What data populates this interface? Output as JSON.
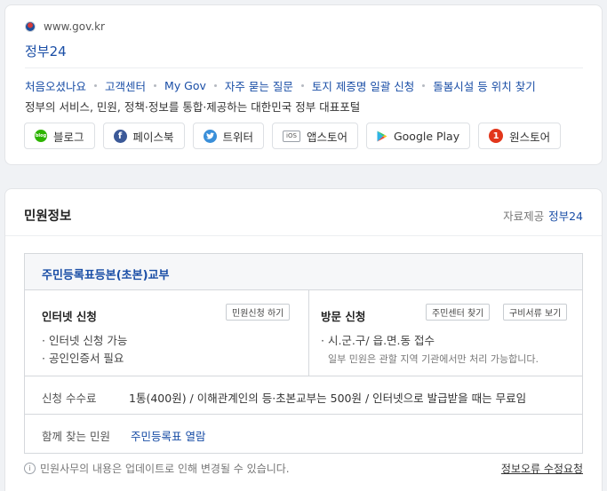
{
  "site": {
    "url": "www.gov.kr",
    "title": "정부24",
    "links": [
      "처음오셨나요",
      "고객센터",
      "My Gov",
      "자주 묻는 질문",
      "토지 제증명 일괄 신청",
      "돌봄시설 등 위치 찾기"
    ],
    "description": "정부의 서비스, 민원, 정책·정보를 통합·제공하는 대한민국 정부 대표포털",
    "apps": [
      {
        "icon": "blog-icon",
        "label": "블로그"
      },
      {
        "icon": "facebook-icon",
        "label": "페이스북"
      },
      {
        "icon": "twitter-icon",
        "label": "트위터"
      },
      {
        "icon": "ios-icon",
        "label": "앱스토어"
      },
      {
        "icon": "google-play-icon",
        "label": "Google Play"
      },
      {
        "icon": "onestore-icon",
        "label": "원스토어"
      }
    ],
    "colors": {
      "link": "#1a4ea6",
      "blog": "#2db400",
      "facebook": "#3b5998",
      "twitter": "#3a8fd9",
      "onestore": "#e2361b"
    }
  },
  "info": {
    "title": "민원정보",
    "source_label": "자료제공",
    "source_link": "정부24",
    "service_name": "주민등록표등본(초본)교부",
    "online": {
      "label": "인터넷 신청",
      "button": "민원신청 하기",
      "items": [
        "· 인터넷 신청 가능",
        "· 공인인증서 필요"
      ]
    },
    "visit": {
      "label": "방문 신청",
      "buttons": [
        "주민센터 찾기",
        "구비서류 보기"
      ],
      "items": [
        "· 시.군.구/ 읍.면.동 접수"
      ],
      "note": "일부 민원은 관할 지역 기관에서만 처리 가능합니다."
    },
    "fee_label": "신청 수수료",
    "fee_value": "1통(400원) / 이해관계인의 등·초본교부는 500원 / 인터넷으로 발급받을 때는 무료임",
    "related_label": "함께 찾는 민원",
    "related_link": "주민등록표 열람",
    "footnote": "민원사무의 내용은 업데이트로 인해 변경될 수 있습니다.",
    "report_link": "정보오류 수정요청"
  }
}
